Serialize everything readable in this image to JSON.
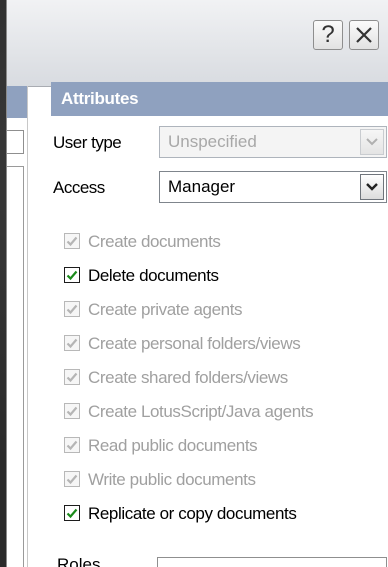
{
  "window": {
    "help_glyph": "?",
    "help_icon": "question-mark",
    "close_icon": "close-x"
  },
  "attributes": {
    "header": "Attributes",
    "user_type_label": "User type",
    "user_type_value": "Unspecified",
    "access_label": "Access",
    "access_value": "Manager"
  },
  "permissions": [
    {
      "label": "Create documents",
      "checked": true,
      "enabled": false
    },
    {
      "label": "Delete documents",
      "checked": true,
      "enabled": true
    },
    {
      "label": "Create private agents",
      "checked": true,
      "enabled": false
    },
    {
      "label": "Create personal folders/views",
      "checked": true,
      "enabled": false
    },
    {
      "label": "Create shared folders/views",
      "checked": true,
      "enabled": false
    },
    {
      "label": "Create LotusScript/Java agents",
      "checked": true,
      "enabled": false
    },
    {
      "label": "Read public documents",
      "checked": true,
      "enabled": false
    },
    {
      "label": "Write public documents",
      "checked": true,
      "enabled": false
    },
    {
      "label": "Replicate or copy documents",
      "checked": true,
      "enabled": true
    }
  ],
  "roles": {
    "label": "Roles"
  },
  "colors": {
    "header_bg": "#8fa1bf",
    "check_enabled": "#1a8a1a",
    "check_disabled": "#b5b5b5",
    "disabled_text": "#a0a0a0"
  }
}
